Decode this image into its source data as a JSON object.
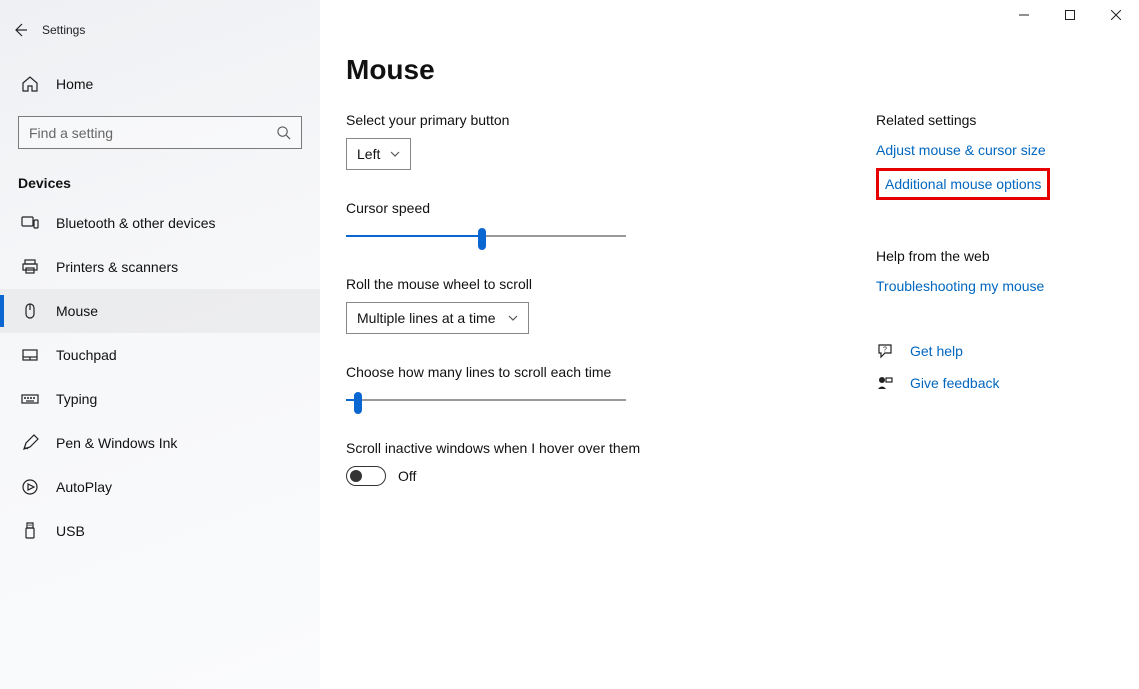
{
  "app_title": "Settings",
  "home_label": "Home",
  "search_placeholder": "Find a setting",
  "category": "Devices",
  "nav": [
    {
      "key": "bluetooth",
      "label": "Bluetooth & other devices"
    },
    {
      "key": "printers",
      "label": "Printers & scanners"
    },
    {
      "key": "mouse",
      "label": "Mouse"
    },
    {
      "key": "touchpad",
      "label": "Touchpad"
    },
    {
      "key": "typing",
      "label": "Typing"
    },
    {
      "key": "pen",
      "label": "Pen & Windows Ink"
    },
    {
      "key": "autoplay",
      "label": "AutoPlay"
    },
    {
      "key": "usb",
      "label": "USB"
    }
  ],
  "page_title": "Mouse",
  "primary_button": {
    "label": "Select your primary button",
    "value": "Left"
  },
  "cursor_speed": {
    "label": "Cursor speed",
    "value": 10,
    "min": 1,
    "max": 20
  },
  "wheel_scroll": {
    "label": "Roll the mouse wheel to scroll",
    "value": "Multiple lines at a time"
  },
  "lines_each": {
    "label": "Choose how many lines to scroll each time",
    "value": 1,
    "min": 1,
    "max": 100
  },
  "inactive": {
    "label": "Scroll inactive windows when I hover over them",
    "state": "Off"
  },
  "related": {
    "heading": "Related settings",
    "link1": "Adjust mouse & cursor size",
    "link2": "Additional mouse options"
  },
  "webhelp": {
    "heading": "Help from the web",
    "link": "Troubleshooting my mouse"
  },
  "support": {
    "get_help": "Get help",
    "feedback": "Give feedback"
  }
}
